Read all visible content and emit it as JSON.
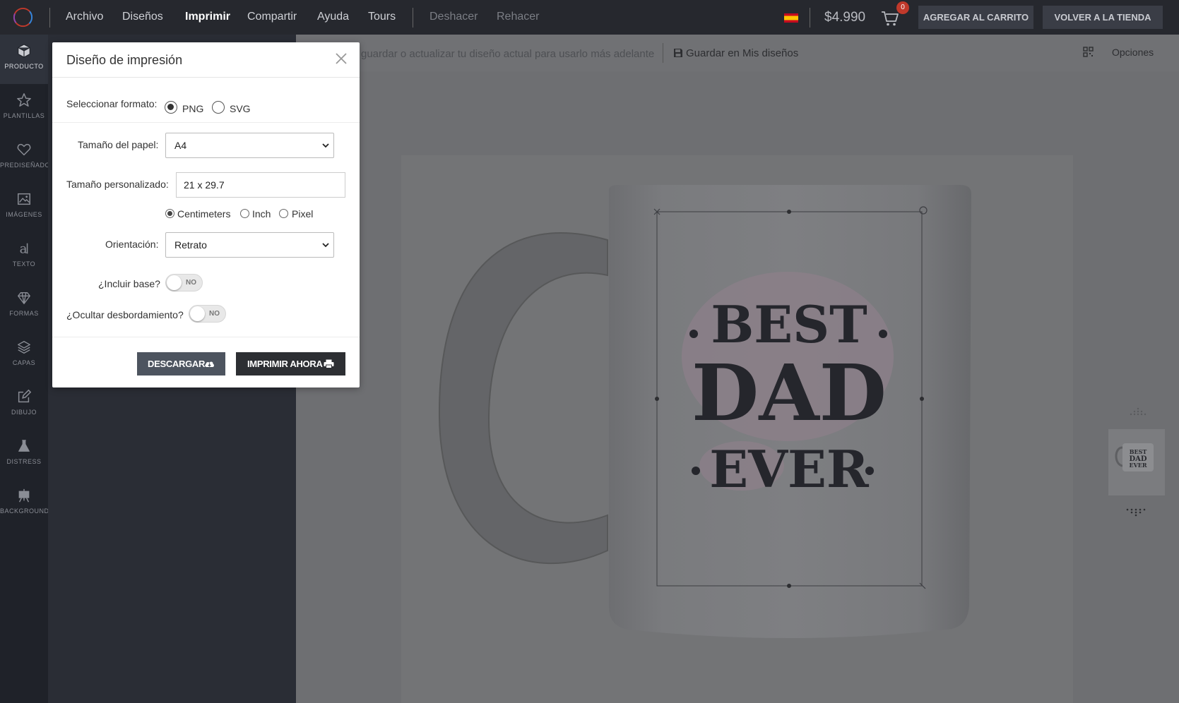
{
  "menu": {
    "items": [
      "Archivo",
      "Diseños",
      "Imprimir",
      "Compartir",
      "Ayuda",
      "Tours"
    ],
    "undo": "Deshacer",
    "redo": "Rehacer"
  },
  "header": {
    "price": "$4.990",
    "cart_count": "0",
    "add_to_cart": "AGREGAR AL CARRITO",
    "back_to_store": "VOLVER A LA TIENDA"
  },
  "sidebar": {
    "items": [
      {
        "label": "PRODUCTO",
        "icon": "cube-icon"
      },
      {
        "label": "PLANTILLAS",
        "icon": "star-icon"
      },
      {
        "label": "PREDISEÑADO",
        "icon": "heart-icon"
      },
      {
        "label": "IMÁGENES",
        "icon": "image-icon"
      },
      {
        "label": "TEXTO",
        "icon": "text-icon"
      },
      {
        "label": "FORMAS",
        "icon": "diamond-icon"
      },
      {
        "label": "CAPAS",
        "icon": "layers-icon"
      },
      {
        "label": "DIBUJO",
        "icon": "edit-icon"
      },
      {
        "label": "DISTRESS",
        "icon": "flask-icon"
      },
      {
        "label": "BACKGROUND",
        "icon": "easel-icon"
      }
    ]
  },
  "info_bar": {
    "message": "guardar o actualizar tu diseño actual para usarlo más adelante",
    "save_label": "Guardar en Mis diseños",
    "options_label": "Opciones"
  },
  "canvas": {
    "design_text": [
      "BEST",
      "DAD",
      "EVER"
    ]
  },
  "modal": {
    "title": "Diseño de impresión",
    "format_label": "Seleccionar formato:",
    "format_options": [
      "PNG",
      "SVG"
    ],
    "format_selected": "PNG",
    "paper_size_label": "Tamaño del papel:",
    "paper_size_value": "A4",
    "custom_size_label": "Tamaño personalizado:",
    "custom_size_value": "21 x 29.7",
    "unit_options": [
      "Centimeters",
      "Inch",
      "Pixel"
    ],
    "unit_selected": "Centimeters",
    "orientation_label": "Orientación:",
    "orientation_value": "Retrato",
    "include_base_label": "¿Incluir base?",
    "include_base_value": "NO",
    "hide_overflow_label": "¿Ocultar desbordamiento?",
    "hide_overflow_value": "NO",
    "download_label": "DESCARGAR",
    "print_label": "IMPRIMIR AHORA"
  },
  "colors": {
    "topbar": "#26282e",
    "sidebar": "#1f2229",
    "canvas": "#6e6f72",
    "primary_button": "#2d2f33",
    "secondary_button": "#4d545f",
    "badge": "#c0392b"
  }
}
